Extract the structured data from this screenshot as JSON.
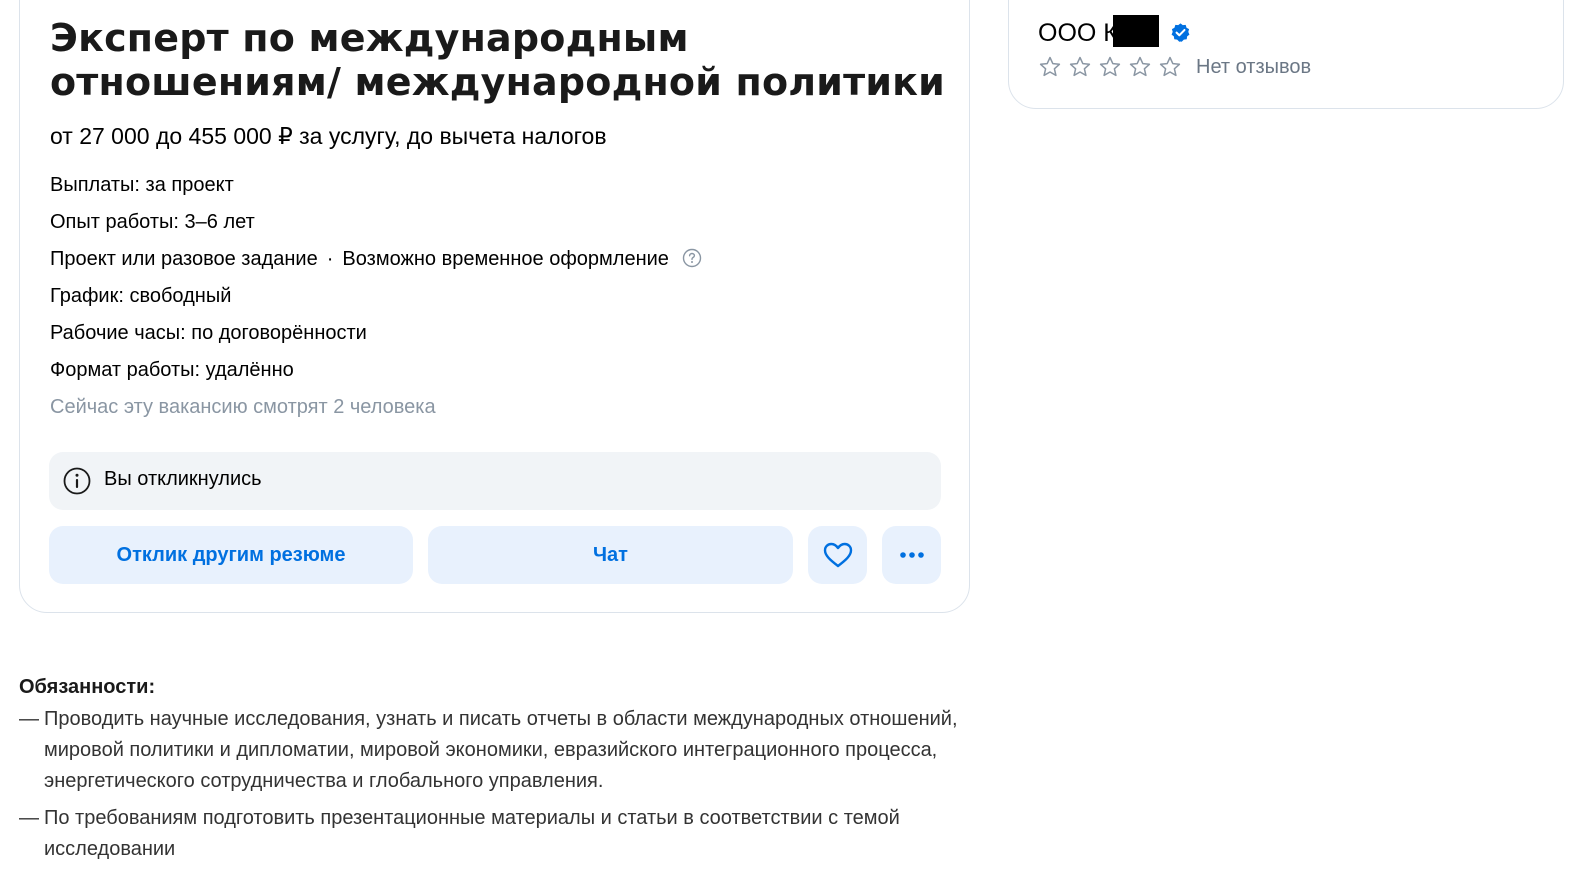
{
  "vacancy": {
    "title": "Эксперт по международным отношениям/ международной политики",
    "salary": "от 27 000 до 455 000 ₽ за услугу, до вычета налогов",
    "payments": "Выплаты: за проект",
    "experience": "Опыт работы: 3–6 лет",
    "employment_type": "Проект или разовое задание",
    "employment_separator": "·",
    "temporary": "Возможно временное оформление",
    "schedule": "График: свободный",
    "hours": "Рабочие часы: по договорённости",
    "work_format": "Формат работы: удалённо",
    "viewers": "Сейчас эту вакансию смотрят 2 человека",
    "responded": "Вы откликнулись",
    "actions": {
      "other_resume_label": "Отклик другим резюме",
      "chat_label": "Чат"
    }
  },
  "employer": {
    "name": "ООО К",
    "rating_max": 5,
    "rating_value": 0,
    "reviews": "Нет отзывов"
  },
  "duties": {
    "title": "Обязанности:",
    "marker": "—",
    "items": [
      "Проводить научные исследования, узнать и писать отчеты в области международных отношений, мировой политики и дипломатии, мировой экономики, евразийского интеграционного процесса, энергетического сотрудничества и глобального управления.",
      "По требованиям подготовить презентационные материалы и статьи в соответствии с темой исследовании"
    ]
  },
  "colors": {
    "accent": "#0070e0",
    "button_bg": "#e8f1fd",
    "muted_text": "#8a96a3",
    "verified": "#0070e0",
    "star_outline": "#8a96a3"
  }
}
